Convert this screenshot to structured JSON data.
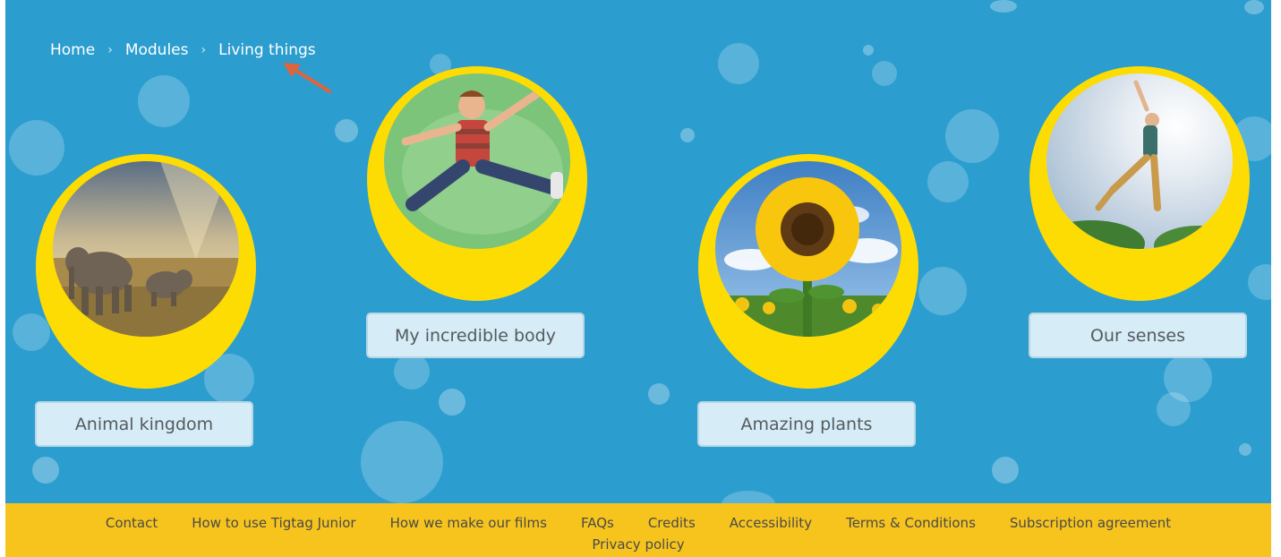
{
  "breadcrumb": {
    "items": [
      "Home",
      "Modules",
      "Living things"
    ],
    "separator": "›"
  },
  "modules": [
    {
      "label": "Animal kingdom",
      "image": "elephants-savanna"
    },
    {
      "label": "My incredible body",
      "image": "boy-jumping"
    },
    {
      "label": "Amazing plants",
      "image": "sunflower"
    },
    {
      "label": "Our senses",
      "image": "person-leaping-sky"
    }
  ],
  "footer": {
    "links": [
      "Contact",
      "How to use Tigtag Junior",
      "How we make our films",
      "FAQs",
      "Credits",
      "Accessibility",
      "Terms & Conditions",
      "Subscription agreement"
    ],
    "privacy": "Privacy policy"
  },
  "colors": {
    "background": "#2b9dcf",
    "blob": "#fddc04",
    "button": "#d6ecf6",
    "footer": "#f7c41d",
    "annotation_arrow": "#e0643a"
  }
}
